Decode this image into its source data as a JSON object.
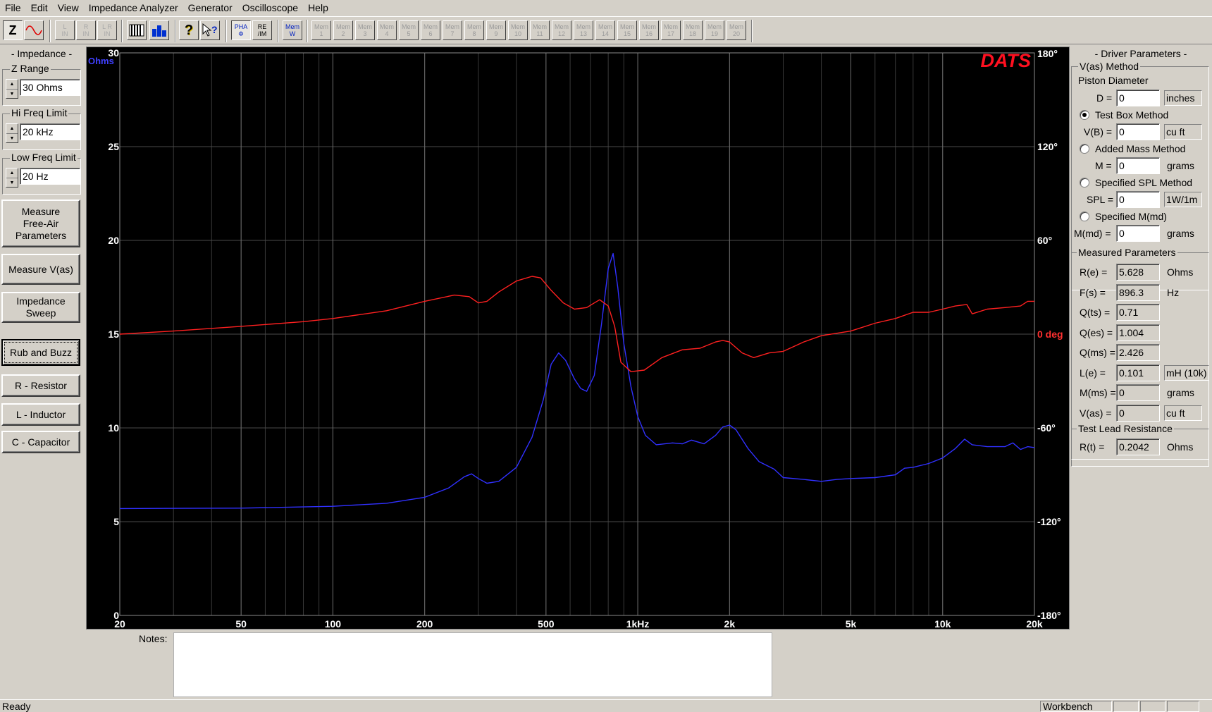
{
  "menu": [
    "File",
    "Edit",
    "View",
    "Impedance Analyzer",
    "Generator",
    "Oscilloscope",
    "Help"
  ],
  "toolbar": {
    "mode_buttons": [
      {
        "label": "Z",
        "icon": "impedance-z-icon"
      },
      {
        "label": "",
        "icon": "sine-wave-icon"
      }
    ],
    "lrc_buttons": [
      "L\nIN",
      "R\nIN",
      "L R\nIN"
    ],
    "analysis_buttons": [
      {
        "icon": "piano-keys-icon"
      },
      {
        "icon": "bar-graph-icon"
      }
    ],
    "help_buttons": [
      {
        "icon": "help-question-icon"
      },
      {
        "icon": "context-help-icon"
      }
    ],
    "display_buttons": [
      "PHA\nΦ",
      "RE\n/IM"
    ],
    "mem_write": "Mem\nW",
    "mem_slots": [
      "Mem\n1",
      "Mem\n2",
      "Mem\n3",
      "Mem\n4",
      "Mem\n5",
      "Mem\n6",
      "Mem\n7",
      "Mem\n8",
      "Mem\n9",
      "Mem\n10",
      "Mem\n11",
      "Mem\n12",
      "Mem\n13",
      "Mem\n14",
      "Mem\n15",
      "Mem\n16",
      "Mem\n17",
      "Mem\n18",
      "Mem\n19",
      "Mem\n20"
    ]
  },
  "left": {
    "title": "- Impedance -",
    "z_range": {
      "legend": "Z Range",
      "value": "30 Ohms"
    },
    "hi_freq": {
      "legend": "Hi Freq Limit",
      "value": "20 kHz"
    },
    "low_freq": {
      "legend": "Low Freq Limit",
      "value": "20 Hz"
    },
    "buttons": [
      "Measure\nFree-Air\nParameters",
      "Measure V(as)",
      "Impedance\nSweep",
      "Rub and Buzz",
      "R - Resistor",
      "L - Inductor",
      "C - Capacitor"
    ]
  },
  "chart_data": {
    "type": "line",
    "logo": "DATS",
    "x_scale": "log",
    "xlim": [
      20,
      20000
    ],
    "x_ticks": [
      {
        "v": 20,
        "label": "20"
      },
      {
        "v": 50,
        "label": "50"
      },
      {
        "v": 100,
        "label": "100"
      },
      {
        "v": 200,
        "label": "200"
      },
      {
        "v": 500,
        "label": "500"
      },
      {
        "v": 1000,
        "label": "1kHz"
      },
      {
        "v": 2000,
        "label": "2k"
      },
      {
        "v": 5000,
        "label": "5k"
      },
      {
        "v": 10000,
        "label": "10k"
      },
      {
        "v": 20000,
        "label": "20k"
      }
    ],
    "y_left": {
      "unit": "Ohms",
      "lim": [
        0,
        30
      ],
      "ticks": [
        0,
        5,
        10,
        15,
        20,
        25,
        30
      ]
    },
    "y_right": {
      "unit": "deg",
      "lim": [
        -180,
        180
      ],
      "ticks": [
        {
          "v": 180,
          "label": "180°"
        },
        {
          "v": 120,
          "label": "120°"
        },
        {
          "v": 60,
          "label": "60°"
        },
        {
          "v": 0,
          "label": "0 deg"
        },
        {
          "v": -60,
          "label": "-60°"
        },
        {
          "v": -120,
          "label": "-120°"
        },
        {
          "v": -180,
          "label": "-180°"
        }
      ]
    },
    "grid": true,
    "series": [
      {
        "color": "#3030ff",
        "axis": "left",
        "points": [
          [
            20,
            5.7
          ],
          [
            50,
            5.72
          ],
          [
            100,
            5.82
          ],
          [
            150,
            5.98
          ],
          [
            200,
            6.3
          ],
          [
            240,
            6.8
          ],
          [
            270,
            7.4
          ],
          [
            285,
            7.55
          ],
          [
            300,
            7.3
          ],
          [
            320,
            7.05
          ],
          [
            350,
            7.15
          ],
          [
            400,
            7.9
          ],
          [
            450,
            9.5
          ],
          [
            490,
            11.5
          ],
          [
            520,
            13.4
          ],
          [
            550,
            14.0
          ],
          [
            580,
            13.6
          ],
          [
            620,
            12.6
          ],
          [
            650,
            12.1
          ],
          [
            680,
            11.95
          ],
          [
            720,
            12.8
          ],
          [
            760,
            15.5
          ],
          [
            800,
            18.5
          ],
          [
            830,
            19.3
          ],
          [
            860,
            17.5
          ],
          [
            900,
            14.5
          ],
          [
            950,
            12.2
          ],
          [
            1000,
            10.6
          ],
          [
            1060,
            9.6
          ],
          [
            1150,
            9.1
          ],
          [
            1300,
            9.2
          ],
          [
            1400,
            9.15
          ],
          [
            1500,
            9.35
          ],
          [
            1650,
            9.15
          ],
          [
            1800,
            9.6
          ],
          [
            1900,
            10.05
          ],
          [
            2000,
            10.15
          ],
          [
            2100,
            9.9
          ],
          [
            2300,
            8.9
          ],
          [
            2500,
            8.2
          ],
          [
            2800,
            7.8
          ],
          [
            3000,
            7.35
          ],
          [
            3500,
            7.25
          ],
          [
            4000,
            7.15
          ],
          [
            4500,
            7.25
          ],
          [
            5000,
            7.3
          ],
          [
            6000,
            7.35
          ],
          [
            7000,
            7.5
          ],
          [
            7500,
            7.85
          ],
          [
            8000,
            7.9
          ],
          [
            9000,
            8.1
          ],
          [
            10000,
            8.4
          ],
          [
            11000,
            8.9
          ],
          [
            11800,
            9.4
          ],
          [
            12500,
            9.1
          ],
          [
            14000,
            9.0
          ],
          [
            16000,
            9.0
          ],
          [
            17000,
            9.2
          ],
          [
            18000,
            8.85
          ],
          [
            19000,
            9.0
          ],
          [
            20000,
            8.95
          ]
        ]
      },
      {
        "color": "#ff2020",
        "axis": "right",
        "points": [
          [
            20,
            0
          ],
          [
            30,
            2
          ],
          [
            50,
            5
          ],
          [
            80,
            8
          ],
          [
            100,
            10
          ],
          [
            150,
            15
          ],
          [
            200,
            21
          ],
          [
            250,
            25
          ],
          [
            280,
            24
          ],
          [
            300,
            20
          ],
          [
            320,
            21
          ],
          [
            350,
            27
          ],
          [
            400,
            34
          ],
          [
            450,
            37
          ],
          [
            480,
            36
          ],
          [
            520,
            28
          ],
          [
            570,
            20
          ],
          [
            620,
            16
          ],
          [
            680,
            17
          ],
          [
            720,
            20
          ],
          [
            750,
            22
          ],
          [
            800,
            18
          ],
          [
            840,
            5
          ],
          [
            880,
            -18
          ],
          [
            950,
            -24
          ],
          [
            1050,
            -23
          ],
          [
            1200,
            -15
          ],
          [
            1400,
            -10
          ],
          [
            1600,
            -9
          ],
          [
            1800,
            -5
          ],
          [
            1900,
            -4
          ],
          [
            2000,
            -5
          ],
          [
            2200,
            -12
          ],
          [
            2400,
            -15
          ],
          [
            2700,
            -12
          ],
          [
            3000,
            -11
          ],
          [
            3500,
            -5
          ],
          [
            4000,
            -1
          ],
          [
            5000,
            2
          ],
          [
            6000,
            7
          ],
          [
            7000,
            10
          ],
          [
            8000,
            14
          ],
          [
            9000,
            14
          ],
          [
            10000,
            16
          ],
          [
            11000,
            18
          ],
          [
            12000,
            19
          ],
          [
            12500,
            13
          ],
          [
            14000,
            16
          ],
          [
            16000,
            17
          ],
          [
            18000,
            18
          ],
          [
            19000,
            21
          ],
          [
            20000,
            21
          ]
        ]
      }
    ]
  },
  "notes_label": "Notes:",
  "right": {
    "title": "- Driver Parameters -",
    "vas_method": "V(as) Method",
    "piston": "Piston Diameter",
    "d": {
      "label": "D =",
      "value": "0",
      "unit": "inches"
    },
    "test_box": {
      "label": "Test Box Method",
      "selected": true
    },
    "vb": {
      "label": "V(B) =",
      "value": "0",
      "unit": "cu ft"
    },
    "added_mass": {
      "label": "Added Mass Method",
      "selected": false
    },
    "m": {
      "label": "M =",
      "value": "0",
      "unit": "grams"
    },
    "spl_method": {
      "label": "Specified SPL Method",
      "selected": false
    },
    "spl": {
      "label": "SPL =",
      "value": "0",
      "unit": "1W/1m"
    },
    "mmd_method": {
      "label": "Specified M(md)",
      "selected": false
    },
    "mmd": {
      "label": "M(md) =",
      "value": "0",
      "unit": "grams"
    },
    "measured_title": "Measured Parameters",
    "measured": [
      {
        "label": "R(e) =",
        "value": "5.628",
        "unit": "Ohms"
      },
      {
        "label": "F(s) =",
        "value": "896.3",
        "unit": "Hz"
      },
      {
        "label": "Q(ts) =",
        "value": "0.71",
        "unit": ""
      },
      {
        "label": "Q(es) =",
        "value": "1.004",
        "unit": ""
      },
      {
        "label": "Q(ms) =",
        "value": "2.426",
        "unit": ""
      },
      {
        "label": "L(e) =",
        "value": "0.101",
        "unit": "mH (10k)"
      },
      {
        "label": "M(ms) =",
        "value": "0",
        "unit": "grams"
      },
      {
        "label": "V(as) =",
        "value": "0",
        "unit": "cu ft"
      }
    ],
    "lead_title": "Test Lead Resistance",
    "lead": {
      "label": "R(t) =",
      "value": "0.2042",
      "unit": "Ohms"
    }
  },
  "status": {
    "text": "Ready",
    "panel": "Workbench"
  }
}
